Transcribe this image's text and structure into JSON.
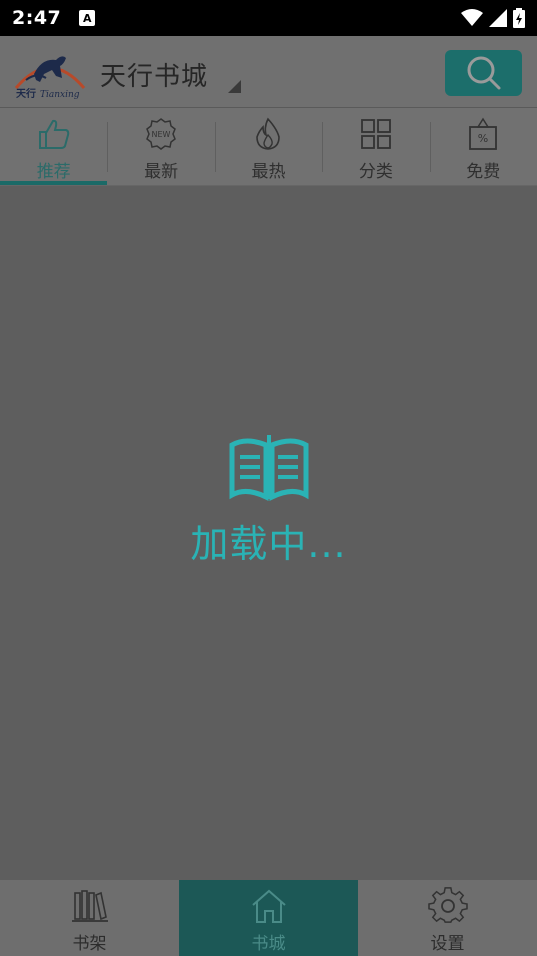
{
  "status_bar": {
    "time": "2:47",
    "notification_icon": "A"
  },
  "header": {
    "title": "天行书城",
    "logo_icon": "tianxing-logo",
    "logo_text": "天行Tianxing",
    "search_icon": "search-icon"
  },
  "tabs": [
    {
      "label": "推荐",
      "icon": "thumbs-up-icon",
      "active": true
    },
    {
      "label": "最新",
      "icon": "new-badge-icon",
      "active": false
    },
    {
      "label": "最热",
      "icon": "flame-icon",
      "active": false
    },
    {
      "label": "分类",
      "icon": "grid-icon",
      "active": false
    },
    {
      "label": "免费",
      "icon": "discount-tag-icon",
      "active": false
    }
  ],
  "loading": {
    "text": "加载中...",
    "icon": "open-book-icon"
  },
  "bottom_nav": [
    {
      "label": "书架",
      "icon": "bookshelf-icon",
      "active": false
    },
    {
      "label": "书城",
      "icon": "home-icon",
      "active": true
    },
    {
      "label": "设置",
      "icon": "gear-icon",
      "active": false
    }
  ],
  "colors": {
    "accent": "#2ab3b5",
    "active_tab": "#1b6a67",
    "overlay_bg": "#5e5e5e"
  }
}
